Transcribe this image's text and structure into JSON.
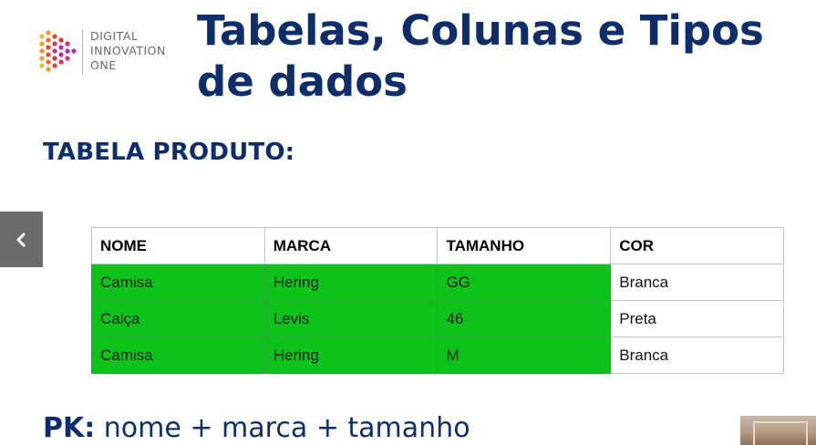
{
  "logo": {
    "lines": [
      "DIGITAL",
      "INNOVATION",
      "ONE"
    ]
  },
  "slide": {
    "title": "Tabelas, Colunas e Tipos de dados",
    "subtitle": "TABELA PRODUTO:",
    "pk_label": "PK:",
    "pk_value": "nome + marca + tamanho"
  },
  "table": {
    "headers": [
      "NOME",
      "MARCA",
      "TAMANHO",
      "COR"
    ],
    "rows": [
      [
        "Camisa",
        "Hering",
        "GG",
        "Branca"
      ],
      [
        "Calça",
        "Levis",
        "46",
        "Preta"
      ],
      [
        "Camisa",
        "Hering",
        "M",
        "Branca"
      ]
    ]
  },
  "icons": {
    "prev": "chevron-left-icon",
    "logo": "dio-logo-icon"
  },
  "colors": {
    "title": "#0d2e6a",
    "highlight": "#0dc31a",
    "nav_button": "#6b6b6b",
    "logo_orange": "#f39a1e",
    "logo_red": "#e8452c",
    "logo_purple": "#b02fb0"
  }
}
